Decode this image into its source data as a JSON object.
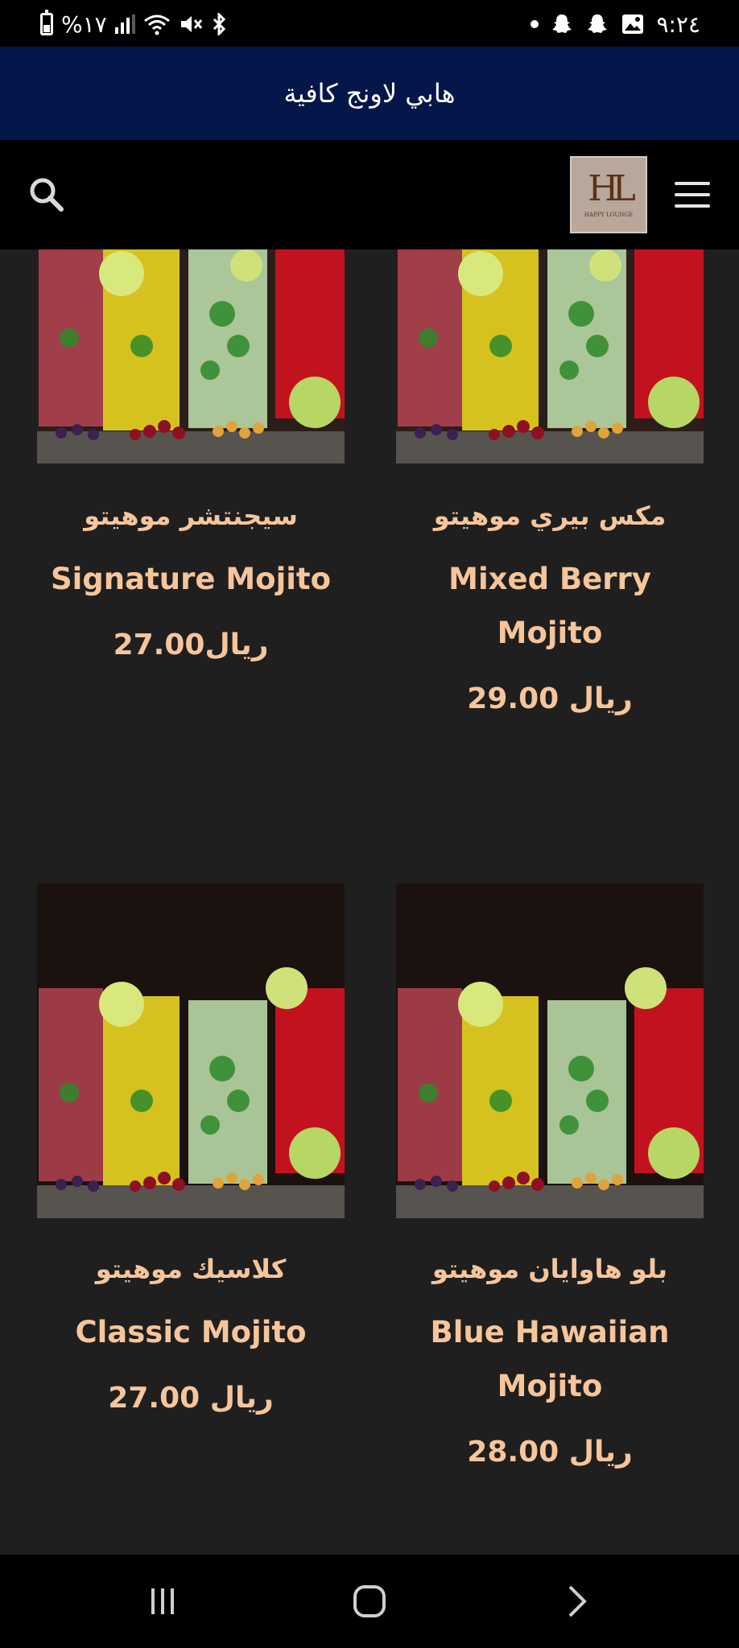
{
  "status": {
    "battery_text": "%١٧",
    "time": "٩:٢٤"
  },
  "header": {
    "title": "هابي لاونج كافية"
  },
  "logo": {
    "monogram": "HL",
    "caption": "HAPPY LOUNGE"
  },
  "products": [
    {
      "name_ar": "سيجنتشر موهيتو",
      "name_en": "Signature Mojito",
      "price": "27.00ريال"
    },
    {
      "name_ar": "مكس بيري موهيتو",
      "name_en": "Mixed Berry Mojito",
      "price": "29.00 ريال"
    },
    {
      "name_ar": "كلاسيك موهيتو",
      "name_en": "Classic Mojito",
      "price": "27.00 ريال"
    },
    {
      "name_ar": "بلو هاوايان موهيتو",
      "name_en": "Blue Hawaiian Mojito",
      "price": "28.00 ريال"
    }
  ],
  "colors": {
    "accent_text": "#f7c59a",
    "header_band": "#05164a",
    "background": "#1f1f1f"
  },
  "icons": {
    "search": "search-icon",
    "menu": "hamburger-menu-icon",
    "recents": "recent-apps-icon",
    "home": "home-icon",
    "back": "back-icon"
  }
}
